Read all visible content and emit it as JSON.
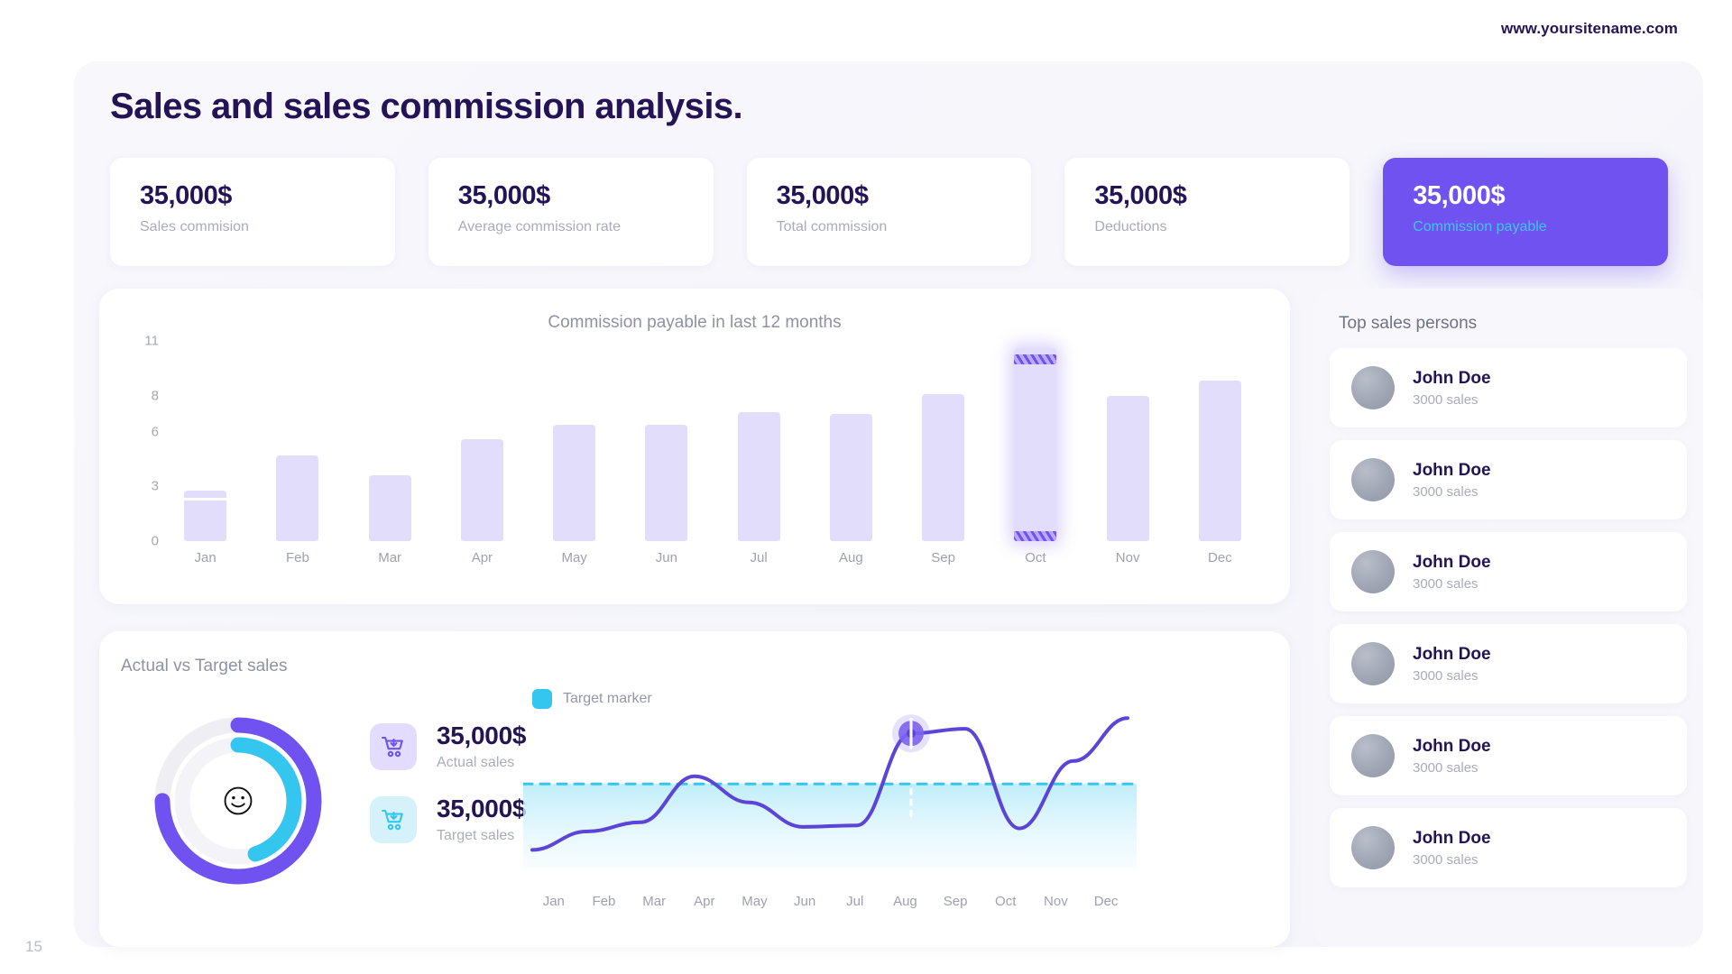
{
  "site_url": "www.yoursitename.com",
  "page_number": "15",
  "header": {
    "title": "Sales and sales commission analysis."
  },
  "kpis": [
    {
      "value": "35,000$",
      "label": "Sales commision",
      "accent": false
    },
    {
      "value": "35,000$",
      "label": "Average commission rate",
      "accent": false
    },
    {
      "value": "35,000$",
      "label": "Total commission",
      "accent": false
    },
    {
      "value": "35,000$",
      "label": "Deductions",
      "accent": false
    },
    {
      "value": "35,000$",
      "label": "Commission payable",
      "accent": true
    }
  ],
  "bar_panel": {
    "title": "Commission payable in last 12 months"
  },
  "line_panel": {
    "title": "Actual vs Target sales",
    "legend_label": "Target marker",
    "stats": [
      {
        "value": "35,000$",
        "label": "Actual sales",
        "icon": "cart-download-icon",
        "tone": "purple"
      },
      {
        "value": "35,000$",
        "label": "Target sales",
        "icon": "cart-download-icon",
        "tone": "cyan"
      }
    ]
  },
  "sidebar": {
    "title": "Top sales persons",
    "people": [
      {
        "name": "John Doe",
        "sales": "3000 sales"
      },
      {
        "name": "John Doe",
        "sales": "3000 sales"
      },
      {
        "name": "John Doe",
        "sales": "3000 sales"
      },
      {
        "name": "John Doe",
        "sales": "3000 sales"
      },
      {
        "name": "John Doe",
        "sales": "3000 sales"
      },
      {
        "name": "John Doe",
        "sales": "3000 sales"
      }
    ]
  },
  "colors": {
    "accent_purple": "#6f52ef",
    "accent_cyan": "#35c6ef",
    "bar_fill": "#e2ddfb",
    "text_dark": "#241456",
    "text_muted": "#a9adbb",
    "panel_bg": "#ffffff",
    "board_bg": "#f7f7fc"
  },
  "chart_data": [
    {
      "type": "bar",
      "title": "Commission payable in last 12 months",
      "xlabel": "",
      "ylabel": "",
      "categories": [
        "Jan",
        "Feb",
        "Mar",
        "Apr",
        "May",
        "Jun",
        "Jul",
        "Aug",
        "Sep",
        "Oct",
        "Nov",
        "Dec"
      ],
      "values": [
        2.8,
        4.7,
        3.6,
        5.6,
        6.4,
        6.4,
        7.1,
        7.0,
        8.1,
        10.6,
        8.0,
        8.8
      ],
      "yticks": [
        0,
        3,
        6,
        8,
        11
      ],
      "ylim": [
        0,
        11
      ],
      "grid": false,
      "legend": "none",
      "highlighted_category": "Oct",
      "highlight_style": "diagonal-striped-bands-top-and-bottom",
      "stacked_segment": {
        "category": "Jan",
        "split_at": 2.4
      }
    },
    {
      "type": "line",
      "title": "Actual vs Target sales",
      "xlabel": "",
      "ylabel": "",
      "x": [
        "Jan",
        "Feb",
        "Mar",
        "Apr",
        "May",
        "Jun",
        "Jul",
        "Aug",
        "Sep",
        "Oct",
        "Nov",
        "Dec"
      ],
      "series": [
        {
          "name": "Actual sales",
          "values": [
            0.8,
            2.0,
            2.6,
            5.6,
            3.9,
            2.3,
            2.4,
            8.4,
            8.7,
            2.2,
            6.6,
            9.4
          ]
        }
      ],
      "target_line": {
        "name": "Target marker",
        "value": 5.1,
        "style": "dashed",
        "color": "#35c6ef"
      },
      "fill_below_target": true,
      "ylim": [
        0,
        10
      ],
      "grid": false,
      "legend": "top-left",
      "legend_entries": [
        "Target marker"
      ],
      "marker": {
        "x": "Aug",
        "y": 8.4
      }
    },
    {
      "type": "pie",
      "title": "Actual vs Target sales",
      "subtype": "donut-dual-ring",
      "rings": [
        {
          "name": "Actual sales",
          "percent": 75,
          "color": "#6f52ef",
          "track": "#e9e9ef"
        },
        {
          "name": "Target sales",
          "percent": 45,
          "color": "#35c6ef",
          "track": "#f2f2f6"
        }
      ],
      "center_icon": "smiley-face-icon"
    }
  ]
}
